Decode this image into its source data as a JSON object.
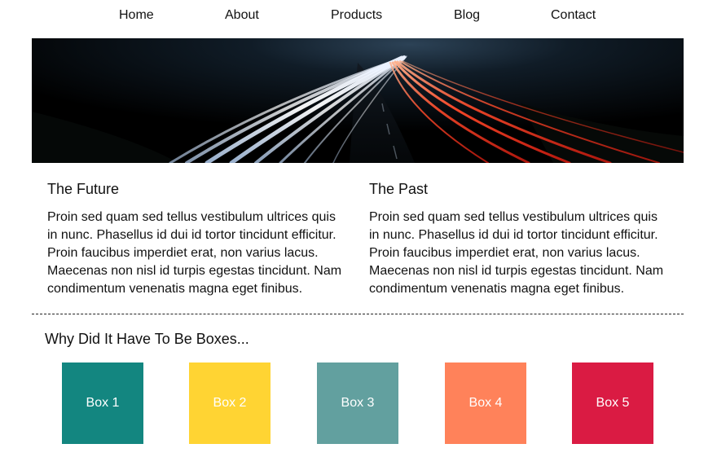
{
  "nav": {
    "items": [
      {
        "label": "Home"
      },
      {
        "label": "About"
      },
      {
        "label": "Products"
      },
      {
        "label": "Blog"
      },
      {
        "label": "Contact"
      }
    ]
  },
  "columns": [
    {
      "title": "The Future",
      "body": "Proin sed quam sed tellus vestibulum ultrices quis in nunc. Phasellus id dui id tortor tincidunt efficitur. Proin faucibus imperdiet erat, non varius lacus. Maecenas non nisl id turpis egestas tincidunt. Nam condimentum venenatis magna eget finibus."
    },
    {
      "title": "The Past",
      "body": "Proin sed quam sed tellus vestibulum ultrices quis in nunc. Phasellus id dui id tortor tincidunt efficitur. Proin faucibus imperdiet erat, non varius lacus. Maecenas non nisl id turpis egestas tincidunt. Nam condimentum venenatis magna eget finibus."
    }
  ],
  "section": {
    "title": "Why Did It Have To Be Boxes..."
  },
  "boxes": [
    {
      "label": "Box 1",
      "color": "#138680"
    },
    {
      "label": "Box 2",
      "color": "#FFD433"
    },
    {
      "label": "Box 3",
      "color": "#62A09F"
    },
    {
      "label": "Box 4",
      "color": "#FF825A"
    },
    {
      "label": "Box 5",
      "color": "#DA1B43"
    }
  ]
}
